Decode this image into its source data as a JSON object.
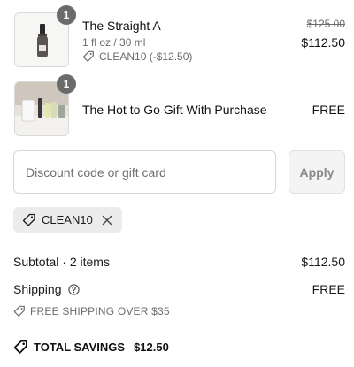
{
  "line_items": [
    {
      "name": "The Straight A",
      "quantity": "1",
      "variant": "1 fl oz / 30 ml",
      "discount": "CLEAN10 (-$12.50)",
      "original_price": "$125.00",
      "price": "$112.50"
    },
    {
      "name": "The Hot to Go Gift With Purchase",
      "quantity": "1",
      "price": "FREE"
    }
  ],
  "discount_form": {
    "placeholder": "Discount code or gift card",
    "apply_label": "Apply"
  },
  "applied_code": {
    "code": "CLEAN10"
  },
  "summary": {
    "subtotal_label": "Subtotal · 2 items",
    "subtotal_value": "$112.50",
    "shipping_label": "Shipping",
    "shipping_value": "FREE",
    "shipping_note": "FREE SHIPPING OVER $35",
    "total_savings_label": "TOTAL SAVINGS",
    "total_savings_value": "$12.50"
  }
}
